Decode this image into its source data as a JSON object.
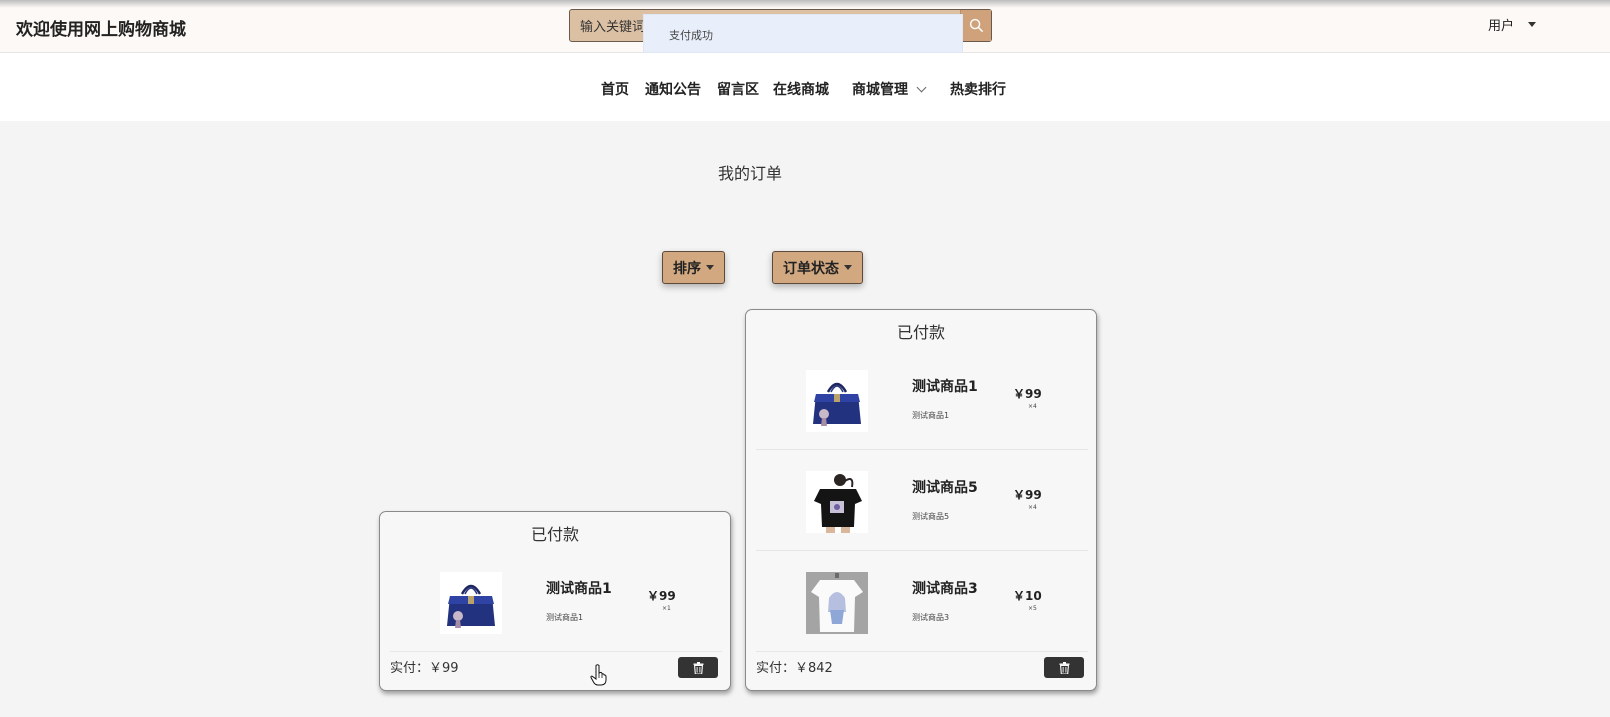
{
  "header": {
    "site_title": "欢迎使用网上购物商城",
    "search": {
      "value": "输入关键词",
      "icon": "search-icon"
    },
    "toast": "支付成功",
    "user": {
      "label": "用户",
      "icon": "caret-down-icon"
    }
  },
  "nav": {
    "items": [
      {
        "label": "首页"
      },
      {
        "label": "通知公告"
      },
      {
        "label": "留言区"
      },
      {
        "label": "在线商城"
      },
      {
        "label": "商城管理",
        "icon": "chevron-down-icon"
      },
      {
        "label": "热卖排行"
      }
    ]
  },
  "main": {
    "title": "我的订单",
    "filters": [
      {
        "label": "排序"
      },
      {
        "label": "订单状态"
      }
    ]
  },
  "orders": [
    {
      "status": "已付款",
      "items": [
        {
          "name": "测试商品1",
          "desc": "测试商品1",
          "price": "￥99",
          "qty": "×1",
          "image": "handbag-image"
        }
      ],
      "paid_label": "实付：￥99"
    },
    {
      "status": "已付款",
      "items": [
        {
          "name": "测试商品1",
          "desc": "测试商品1",
          "price": "￥99",
          "qty": "×4",
          "image": "handbag-image"
        },
        {
          "name": "测试商品5",
          "desc": "测试商品5",
          "price": "￥99",
          "qty": "×4",
          "image": "black-tshirt-image"
        },
        {
          "name": "测试商品3",
          "desc": "测试商品3",
          "price": "￥10",
          "qty": "×5",
          "image": "white-tshirt-image"
        }
      ],
      "paid_label": "实付：￥842"
    }
  ],
  "colors": {
    "accent": "#d2a881",
    "search_bg": "#dcc0a4",
    "toast_bg": "#e9effa",
    "delete_button": "#333333"
  }
}
